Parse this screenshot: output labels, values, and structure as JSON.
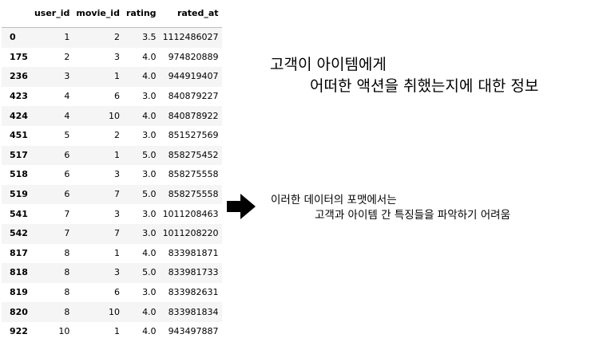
{
  "table": {
    "columns": [
      "",
      "user_id",
      "movie_id",
      "rating",
      "rated_at"
    ],
    "rows": [
      {
        "index": "0",
        "user_id": "1",
        "movie_id": "2",
        "rating": "3.5",
        "rated_at": "1112486027"
      },
      {
        "index": "175",
        "user_id": "2",
        "movie_id": "3",
        "rating": "4.0",
        "rated_at": "974820889"
      },
      {
        "index": "236",
        "user_id": "3",
        "movie_id": "1",
        "rating": "4.0",
        "rated_at": "944919407"
      },
      {
        "index": "423",
        "user_id": "4",
        "movie_id": "6",
        "rating": "3.0",
        "rated_at": "840879227"
      },
      {
        "index": "424",
        "user_id": "4",
        "movie_id": "10",
        "rating": "4.0",
        "rated_at": "840878922"
      },
      {
        "index": "451",
        "user_id": "5",
        "movie_id": "2",
        "rating": "3.0",
        "rated_at": "851527569"
      },
      {
        "index": "517",
        "user_id": "6",
        "movie_id": "1",
        "rating": "5.0",
        "rated_at": "858275452"
      },
      {
        "index": "518",
        "user_id": "6",
        "movie_id": "3",
        "rating": "3.0",
        "rated_at": "858275558"
      },
      {
        "index": "519",
        "user_id": "6",
        "movie_id": "7",
        "rating": "5.0",
        "rated_at": "858275558"
      },
      {
        "index": "541",
        "user_id": "7",
        "movie_id": "3",
        "rating": "3.0",
        "rated_at": "1011208463"
      },
      {
        "index": "542",
        "user_id": "7",
        "movie_id": "7",
        "rating": "3.0",
        "rated_at": "1011208220"
      },
      {
        "index": "817",
        "user_id": "8",
        "movie_id": "1",
        "rating": "4.0",
        "rated_at": "833981871"
      },
      {
        "index": "818",
        "user_id": "8",
        "movie_id": "3",
        "rating": "5.0",
        "rated_at": "833981733"
      },
      {
        "index": "819",
        "user_id": "8",
        "movie_id": "6",
        "rating": "3.0",
        "rated_at": "833982631"
      },
      {
        "index": "820",
        "user_id": "8",
        "movie_id": "10",
        "rating": "4.0",
        "rated_at": "833981834"
      },
      {
        "index": "922",
        "user_id": "10",
        "movie_id": "1",
        "rating": "4.0",
        "rated_at": "943497887"
      }
    ]
  },
  "note_top": {
    "line1": "고객이 아이템에게",
    "line2": "어떠한 액션을 취했는지에 대한 정보"
  },
  "arrow": {
    "icon": "right-arrow-icon",
    "color": "#000000"
  },
  "note_bottom": {
    "line1": "이러한 데이터의 포맷에서는",
    "line2": "고객과 아이템 간 특징들을 파악하기 어려움"
  }
}
